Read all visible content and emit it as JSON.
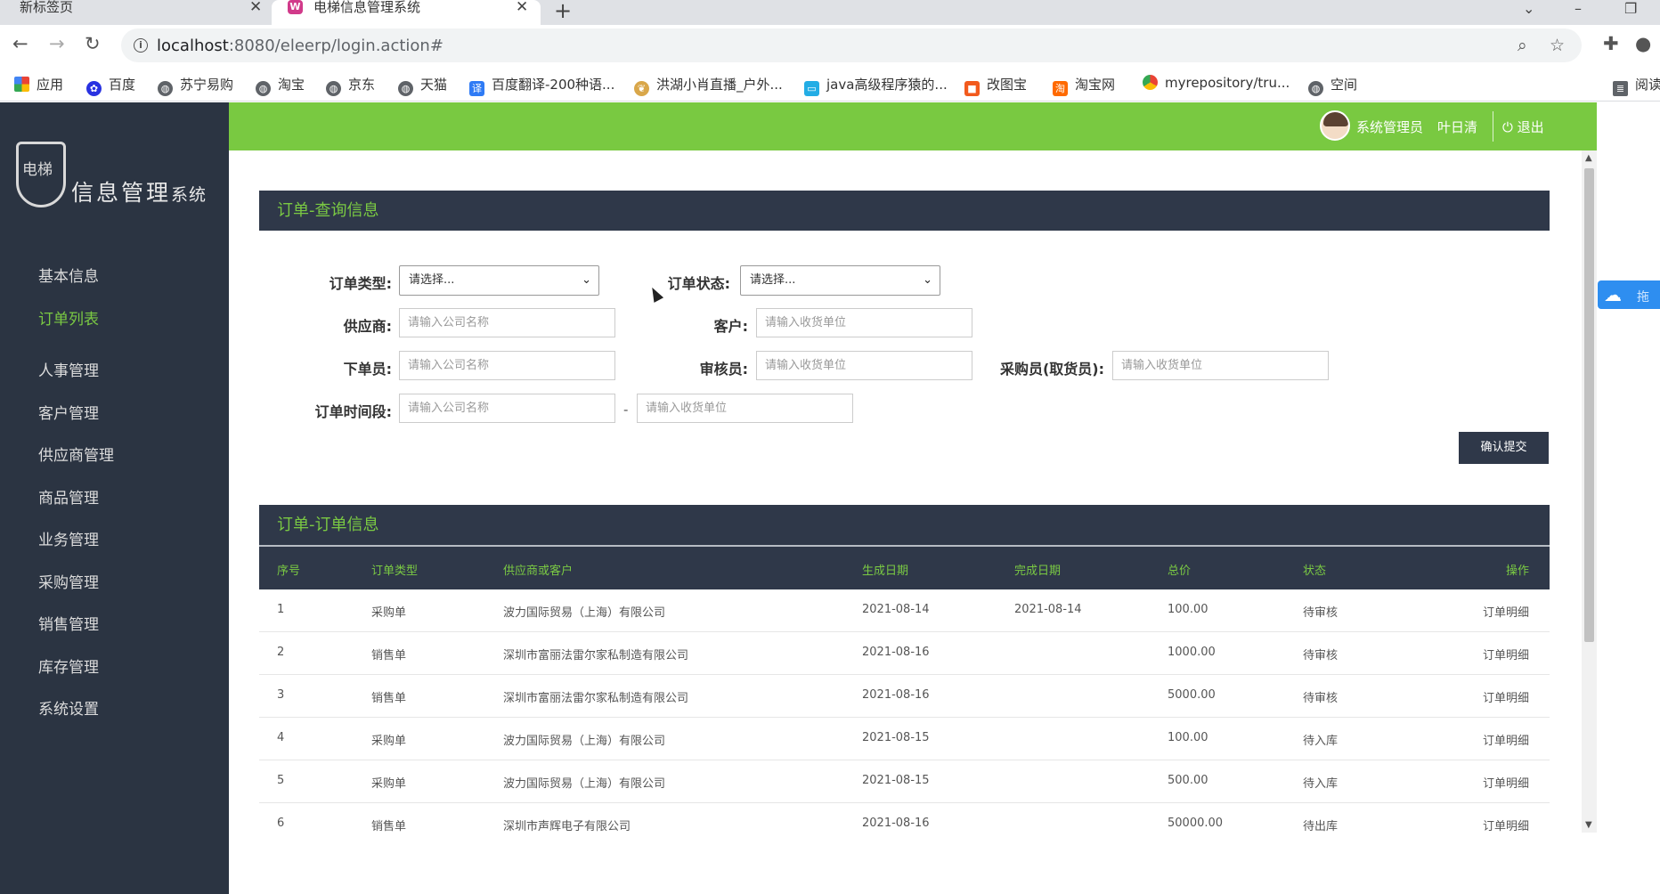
{
  "browser": {
    "tabs": [
      {
        "title": "新标签页",
        "close": "✕"
      },
      {
        "title": "电梯信息管理系统",
        "close": "✕"
      }
    ],
    "new_tab": "+",
    "url_host": "localhost",
    "url_path": ":8080/eleerp/login.action#",
    "bookmarks": [
      {
        "label": "应用",
        "icon": "apps-grid-icon"
      },
      {
        "label": "百度",
        "icon": "baidu-paw-icon"
      },
      {
        "label": "苏宁易购",
        "icon": "globe-icon"
      },
      {
        "label": "淘宝",
        "icon": "globe-icon"
      },
      {
        "label": "京东",
        "icon": "globe-icon"
      },
      {
        "label": "天猫",
        "icon": "globe-icon"
      },
      {
        "label": "百度翻译-200种语...",
        "icon": "translate-icon"
      },
      {
        "label": "洪湖小肖直播_户外...",
        "icon": "feather-icon"
      },
      {
        "label": "java高级程序猿的...",
        "icon": "bilibili-icon"
      },
      {
        "label": "改图宝",
        "icon": "gaitubao-icon"
      },
      {
        "label": "淘宝网",
        "icon": "taobao-icon"
      },
      {
        "label": "myrepository/tru...",
        "icon": "chrome-icon"
      },
      {
        "label": "空间",
        "icon": "globe-icon"
      },
      {
        "label": "阅读",
        "icon": "reading-list-icon"
      }
    ]
  },
  "app": {
    "logo": {
      "shield_text": "电梯",
      "title": "信息管理",
      "title_small": "系统"
    },
    "sidebar": [
      {
        "label": "基本信息",
        "active": false
      },
      {
        "label": "订单列表",
        "active": true
      },
      {
        "label": "人事管理",
        "active": false
      },
      {
        "label": "客户管理",
        "active": false
      },
      {
        "label": "供应商管理",
        "active": false
      },
      {
        "label": "商品管理",
        "active": false
      },
      {
        "label": "业务管理",
        "active": false
      },
      {
        "label": "采购管理",
        "active": false
      },
      {
        "label": "销售管理",
        "active": false
      },
      {
        "label": "库存管理",
        "active": false
      },
      {
        "label": "系统设置",
        "active": false
      }
    ],
    "user": {
      "role": "系统管理员",
      "name": "叶日清",
      "logout": "退出"
    },
    "float_widget": {
      "text": "拖"
    },
    "query_panel": {
      "title": "订单-查询信息",
      "order_type_label": "订单类型:",
      "order_type_value": "请选择...",
      "order_status_label": "订单状态:",
      "order_status_value": "请选择...",
      "supplier_label": "供应商:",
      "supplier_placeholder": "请输入公司名称",
      "customer_label": "客户:",
      "customer_placeholder": "请输入收货单位",
      "placer_label": "下单员:",
      "placer_placeholder": "请输入公司名称",
      "auditor_label": "审核员:",
      "auditor_placeholder": "请输入收货单位",
      "buyer_label": "采购员(取货员):",
      "buyer_placeholder": "请输入收货单位",
      "period_label": "订单时间段:",
      "period_start_placeholder": "请输入公司名称",
      "period_end_placeholder": "请输入收货单位",
      "dash": "-",
      "submit": "确认提交"
    },
    "orders_panel": {
      "title": "订单-订单信息",
      "headers": [
        "序号",
        "订单类型",
        "供应商或客户",
        "生成日期",
        "完成日期",
        "总价",
        "状态",
        "操作"
      ],
      "rows": [
        [
          "1",
          "采购单",
          "波力国际贸易（上海）有限公司",
          "2021-08-14",
          "2021-08-14",
          "100.00",
          "待审核",
          "订单明细"
        ],
        [
          "2",
          "销售单",
          "深圳市富丽法雷尔家私制造有限公司",
          "2021-08-16",
          "",
          "1000.00",
          "待审核",
          "订单明细"
        ],
        [
          "3",
          "销售单",
          "深圳市富丽法雷尔家私制造有限公司",
          "2021-08-16",
          "",
          "5000.00",
          "待审核",
          "订单明细"
        ],
        [
          "4",
          "采购单",
          "波力国际贸易（上海）有限公司",
          "2021-08-15",
          "",
          "100.00",
          "待入库",
          "订单明细"
        ],
        [
          "5",
          "采购单",
          "波力国际贸易（上海）有限公司",
          "2021-08-15",
          "",
          "500.00",
          "待入库",
          "订单明细"
        ],
        [
          "6",
          "销售单",
          "深圳市声辉电子有限公司",
          "2021-08-16",
          "",
          "50000.00",
          "待出库",
          "订单明细"
        ]
      ]
    }
  },
  "colors": {
    "accent_green": "#7ac943",
    "dark_navy": "#2f3849",
    "sidebar_bg": "#2b3442"
  }
}
